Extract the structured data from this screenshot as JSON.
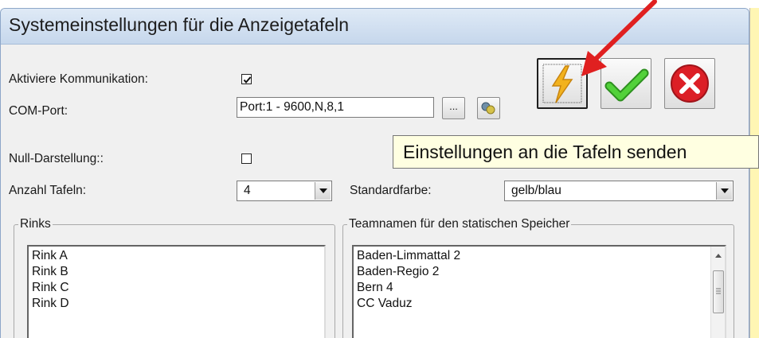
{
  "window": {
    "title": "Systemeinstellungen für die Anzeigetafeln"
  },
  "form": {
    "activate_label": "Aktiviere Kommunikation:",
    "activate_checked": true,
    "comport_label": "COM-Port:",
    "comport_value": "Port:1 - 9600,N,8,1",
    "browse_label": "...",
    "null_label": "Null-Darstellung::",
    "null_checked": false,
    "count_label": "Anzahl Tafeln:",
    "count_value": "4",
    "color_label": "Standardfarbe:",
    "color_value": "gelb/blau"
  },
  "tooltip": {
    "text": "Einstellungen an die Tafeln senden"
  },
  "rinks": {
    "legend": "Rinks",
    "items": [
      "Rink A",
      "Rink B",
      "Rink C",
      "Rink D"
    ]
  },
  "teams": {
    "legend": "Teamnamen für den statischen Speicher",
    "items": [
      "Baden-Limmattal 2",
      "Baden-Regio 2",
      "Bern 4",
      "CC Vaduz"
    ]
  },
  "icons": {
    "send": "lightning-icon",
    "ok": "checkmark-icon",
    "cancel": "cancel-icon",
    "connection": "connection-icon",
    "annotation": "red-arrow"
  },
  "colors": {
    "accent_red": "#e02020",
    "check_green": "#3bbd2b",
    "lightning": "#f2b21e",
    "tooltip_bg": "#ffffe1"
  }
}
